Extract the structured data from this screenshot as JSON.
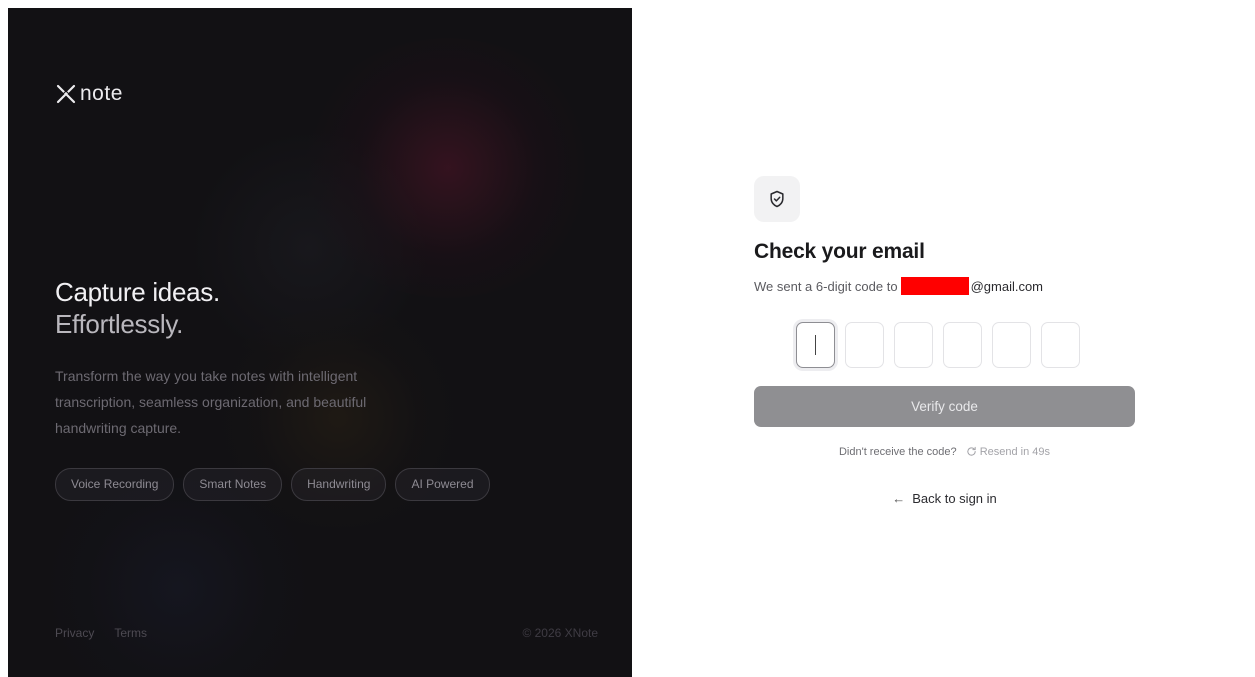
{
  "brand": {
    "name": "note",
    "logo_icon": "x-logo-icon"
  },
  "hero": {
    "headline": "Capture ideas.",
    "subheadline": "Effortlessly.",
    "description": "Transform the way you take notes with intelligent transcription, seamless organization, and beautiful handwriting capture."
  },
  "features": [
    {
      "label": "Voice Recording"
    },
    {
      "label": "Smart Notes"
    },
    {
      "label": "Handwriting"
    },
    {
      "label": "AI Powered"
    }
  ],
  "footer": {
    "privacy_label": "Privacy",
    "terms_label": "Terms",
    "copyright": "© 2026 XNote"
  },
  "verify": {
    "icon": "shield-check-icon",
    "title": "Check your email",
    "subtitle_prefix": "We sent a 6-digit code to",
    "email_suffix": "@gmail.com",
    "code_length": 6,
    "button_label": "Verify code",
    "resend_prompt": "Didn't receive the code?",
    "resend_label": "Resend in 49s",
    "back_label": "Back to sign in"
  },
  "colors": {
    "left_bg": "#121114",
    "button_disabled": "#8f8f92",
    "redaction": "#ff0000"
  }
}
